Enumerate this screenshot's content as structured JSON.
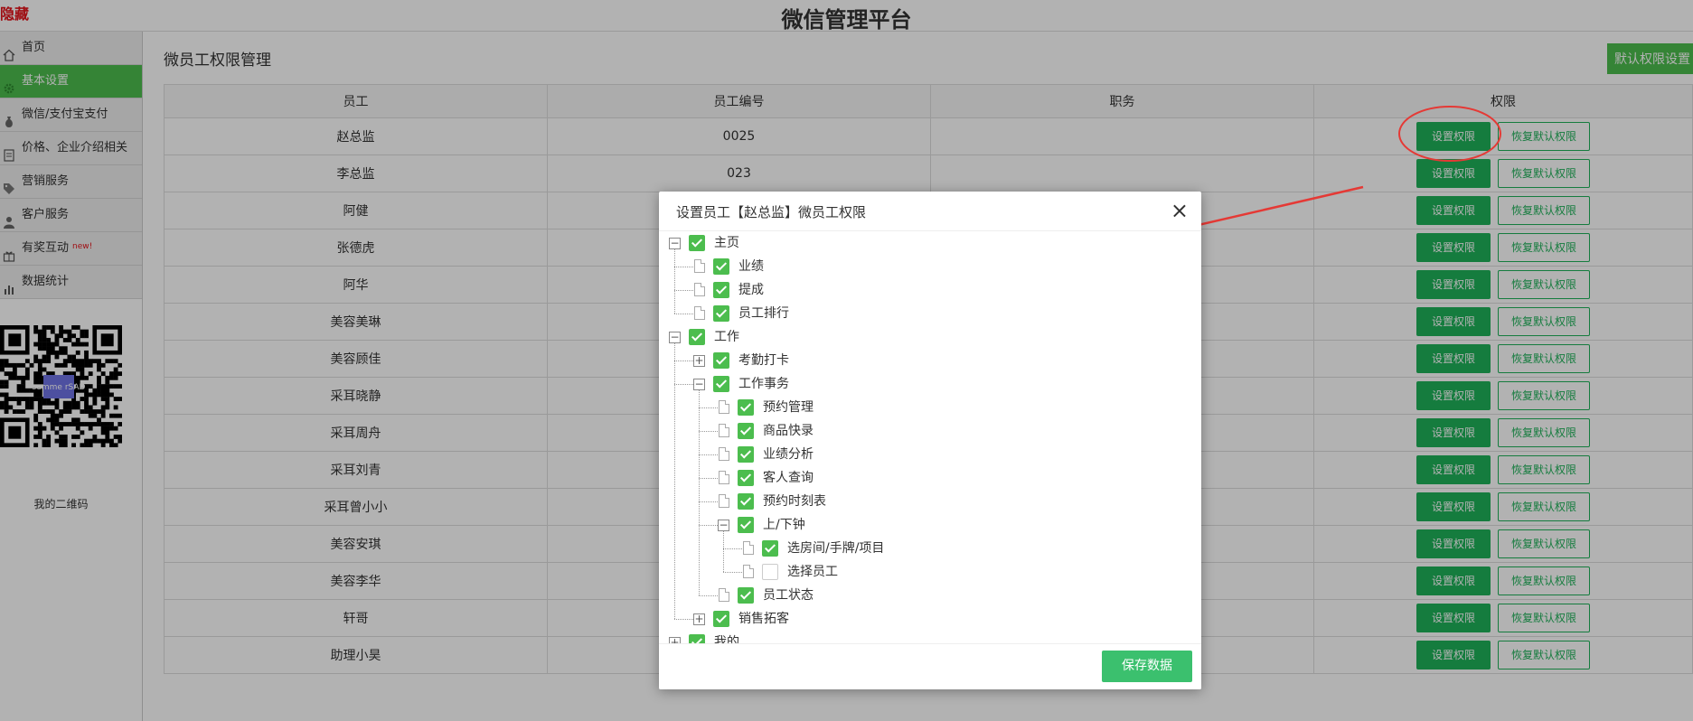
{
  "topbar": {
    "hide_link": "隐藏",
    "title": "微信管理平台"
  },
  "sidebar": {
    "items": [
      {
        "label": "首页",
        "icon": "home-icon",
        "active": false,
        "badge": ""
      },
      {
        "label": "基本设置",
        "icon": "gear-icon",
        "active": true,
        "badge": ""
      },
      {
        "label": "微信/支付宝支付",
        "icon": "money-bag-icon",
        "active": false,
        "badge": ""
      },
      {
        "label": "价格、企业介绍相关",
        "icon": "document-icon",
        "active": false,
        "badge": ""
      },
      {
        "label": "营销服务",
        "icon": "tag-icon",
        "active": false,
        "badge": ""
      },
      {
        "label": "客户服务",
        "icon": "person-icon",
        "active": false,
        "badge": ""
      },
      {
        "label": "有奖互动",
        "icon": "gift-icon",
        "active": false,
        "badge": "new!"
      },
      {
        "label": "数据统计",
        "icon": "bar-chart-icon",
        "active": false,
        "badge": ""
      }
    ],
    "qr": {
      "center_text": "summe rSAD",
      "label": "我的二维码"
    }
  },
  "main": {
    "title": "微员工权限管理",
    "default_button": "默认权限设置",
    "table": {
      "headers": [
        "员工",
        "员工编号",
        "职务",
        "权限"
      ],
      "set_label": "设置权限",
      "reset_label": "恢复默认权限",
      "rows": [
        {
          "name": "赵总监",
          "code": "0025",
          "role": ""
        },
        {
          "name": "李总监",
          "code": "023",
          "role": ""
        },
        {
          "name": "阿健",
          "code": "",
          "role": ""
        },
        {
          "name": "张德虎",
          "code": "",
          "role": ""
        },
        {
          "name": "阿华",
          "code": "",
          "role": ""
        },
        {
          "name": "美容美琳",
          "code": "",
          "role": ""
        },
        {
          "name": "美容顾佳",
          "code": "",
          "role": ""
        },
        {
          "name": "采耳晓静",
          "code": "",
          "role": ""
        },
        {
          "name": "采耳周舟",
          "code": "",
          "role": ""
        },
        {
          "name": "采耳刘青",
          "code": "",
          "role": ""
        },
        {
          "name": "采耳曾小小",
          "code": "",
          "role": ""
        },
        {
          "name": "美容安琪",
          "code": "",
          "role": ""
        },
        {
          "name": "美容李华",
          "code": "",
          "role": ""
        },
        {
          "name": "轩哥",
          "code": "",
          "role": ""
        },
        {
          "name": "助理小昊",
          "code": "",
          "role": ""
        }
      ]
    }
  },
  "modal": {
    "title": "设置员工【赵总监】微员工权限",
    "close": "×",
    "save": "保存数据",
    "tree": [
      {
        "label": "主页",
        "level": 0,
        "type": "expanded",
        "checked": true
      },
      {
        "label": "业绩",
        "level": 1,
        "type": "leaf",
        "checked": true
      },
      {
        "label": "提成",
        "level": 1,
        "type": "leaf",
        "checked": true
      },
      {
        "label": "员工排行",
        "level": 1,
        "type": "leaf",
        "checked": true
      },
      {
        "label": "工作",
        "level": 0,
        "type": "expanded",
        "checked": true
      },
      {
        "label": "考勤打卡",
        "level": 1,
        "type": "collapsed",
        "checked": true
      },
      {
        "label": "工作事务",
        "level": 1,
        "type": "expanded",
        "checked": true
      },
      {
        "label": "预约管理",
        "level": 2,
        "type": "leaf",
        "checked": true
      },
      {
        "label": "商品快录",
        "level": 2,
        "type": "leaf",
        "checked": true
      },
      {
        "label": "业绩分析",
        "level": 2,
        "type": "leaf",
        "checked": true
      },
      {
        "label": "客人查询",
        "level": 2,
        "type": "leaf",
        "checked": true
      },
      {
        "label": "预约时刻表",
        "level": 2,
        "type": "leaf",
        "checked": true
      },
      {
        "label": "上/下钟",
        "level": 2,
        "type": "expanded",
        "checked": true
      },
      {
        "label": "选房间/手牌/项目",
        "level": 3,
        "type": "leaf",
        "checked": true
      },
      {
        "label": "选择员工",
        "level": 3,
        "type": "leaf",
        "checked": false
      },
      {
        "label": "员工状态",
        "level": 2,
        "type": "leaf",
        "checked": true
      },
      {
        "label": "销售拓客",
        "level": 1,
        "type": "collapsed",
        "checked": true
      },
      {
        "label": "我的",
        "level": 0,
        "type": "collapsed",
        "checked": true
      }
    ]
  },
  "colors": {
    "accent": "#4cbd4e",
    "button_green": "#1fb25a",
    "save_green": "#3bc06e",
    "annotation_red": "#e53935"
  }
}
